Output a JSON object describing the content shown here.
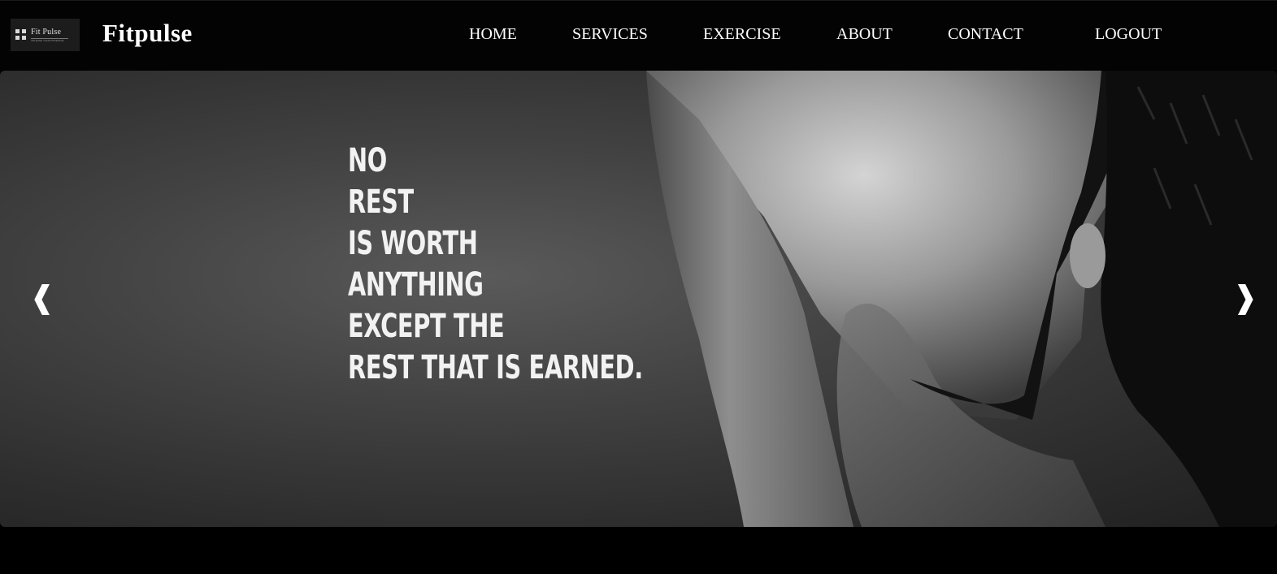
{
  "header": {
    "logo": {
      "text": "Fit Pulse",
      "tagline": "UNLEASH YOUR POTENTIAL"
    },
    "brand": "Fitpulse",
    "nav": {
      "home": "HOME",
      "services": "SERVICES",
      "exercise": "EXERCISE",
      "about": "ABOUT",
      "contact": "CONTACT",
      "logout": "LOGOUT"
    }
  },
  "hero": {
    "quote_lines": [
      "NO",
      "REST",
      "IS WORTH",
      "ANYTHING",
      "EXCEPT THE",
      "REST THAT IS EARNED."
    ],
    "prev_arrow": "❰",
    "next_arrow": "❱"
  },
  "colors": {
    "background": "#000000",
    "nav_text": "#ffffff",
    "hero_tone": "#434343"
  },
  "icons": {
    "logo": "four-square-logo-icon",
    "prev": "chevron-left-icon",
    "next": "chevron-right-icon"
  }
}
